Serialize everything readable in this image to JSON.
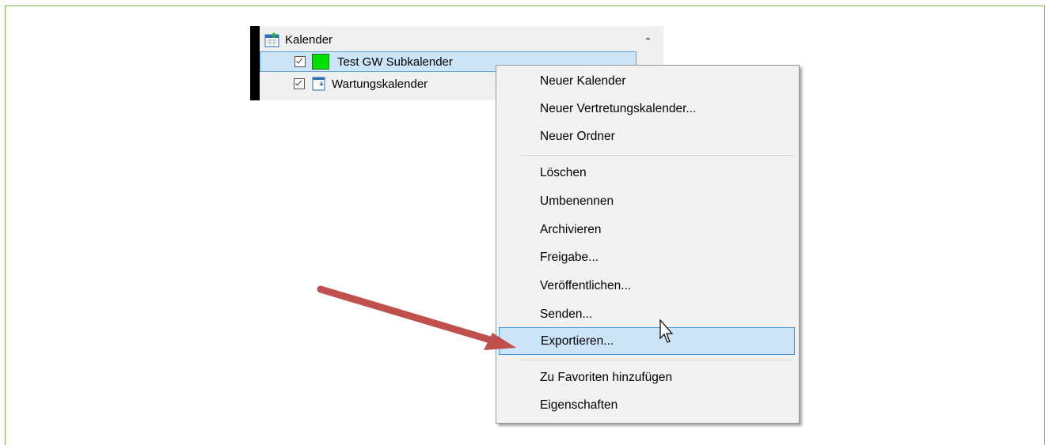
{
  "tree": {
    "root_label": "Kalender",
    "items": [
      {
        "label": "Test GW Subkalender",
        "checked": true,
        "color": "#00e000"
      },
      {
        "label": "Wartungskalender",
        "checked": true
      }
    ]
  },
  "context_menu": {
    "groups": [
      [
        "Neuer Kalender",
        "Neuer Vertretungskalender...",
        "Neuer Ordner"
      ],
      [
        "Löschen",
        "Umbenennen",
        "Archivieren",
        "Freigabe...",
        "Veröffentlichen...",
        "Senden...",
        "Exportieren..."
      ],
      [
        "Zu Favoriten hinzufügen",
        "Eigenschaften"
      ]
    ],
    "highlighted": "Exportieren..."
  },
  "colors": {
    "frame_border": "#7ab648",
    "selection_bg": "#cce4f7",
    "selection_border": "#3d9ae0",
    "arrow": "#c0504d"
  }
}
